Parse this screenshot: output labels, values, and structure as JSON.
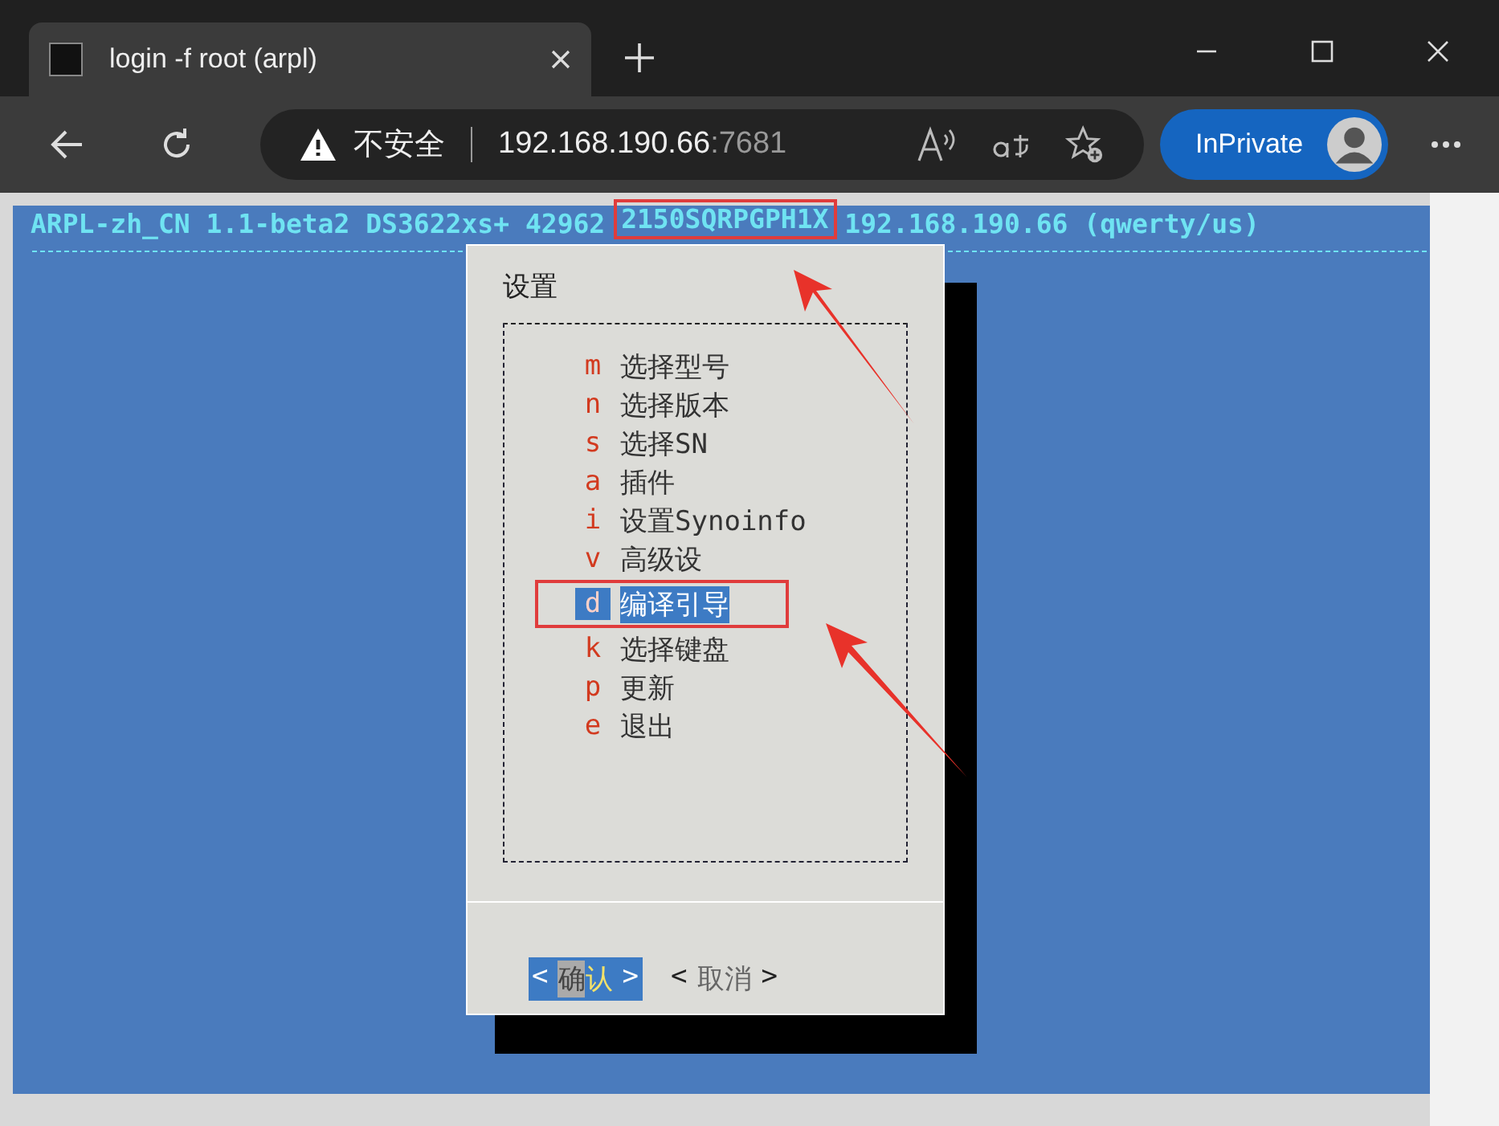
{
  "browser": {
    "tab_title": "login -f root (arpl)",
    "security": "不安全",
    "url_host": "192.168.190.66",
    "url_port": ":7681",
    "inprivate": "InPrivate"
  },
  "terminal": {
    "header": [
      "ARPL-zh_CN 1.1-beta2 DS3622xs+ 42962 ",
      "2150SQRPGPH1X",
      " 192.168.190.66 (qwerty/us)"
    ],
    "dialog": {
      "title": "设置",
      "items": [
        {
          "key": "m",
          "label": "选择型号",
          "selected": false
        },
        {
          "key": "n",
          "label": "选择版本",
          "selected": false
        },
        {
          "key": "s",
          "label": "选择SN",
          "selected": false
        },
        {
          "key": "a",
          "label": "插件",
          "selected": false
        },
        {
          "key": "i",
          "label": "设置Synoinfo",
          "selected": false
        },
        {
          "key": "v",
          "label": "高级设",
          "selected": false
        },
        {
          "key": "d",
          "label": "编译引导",
          "selected": true
        },
        {
          "key": "k",
          "label": "选择键盘",
          "selected": false
        },
        {
          "key": "p",
          "label": "更新",
          "selected": false
        },
        {
          "key": "e",
          "label": "退出",
          "selected": false
        }
      ],
      "buttons": [
        {
          "open": "<",
          "first": "确",
          "rest": "认",
          "close": ">",
          "selected": true
        },
        {
          "open": "<",
          "first": "取",
          "rest": "消",
          "close": ">",
          "selected": false
        }
      ]
    }
  }
}
